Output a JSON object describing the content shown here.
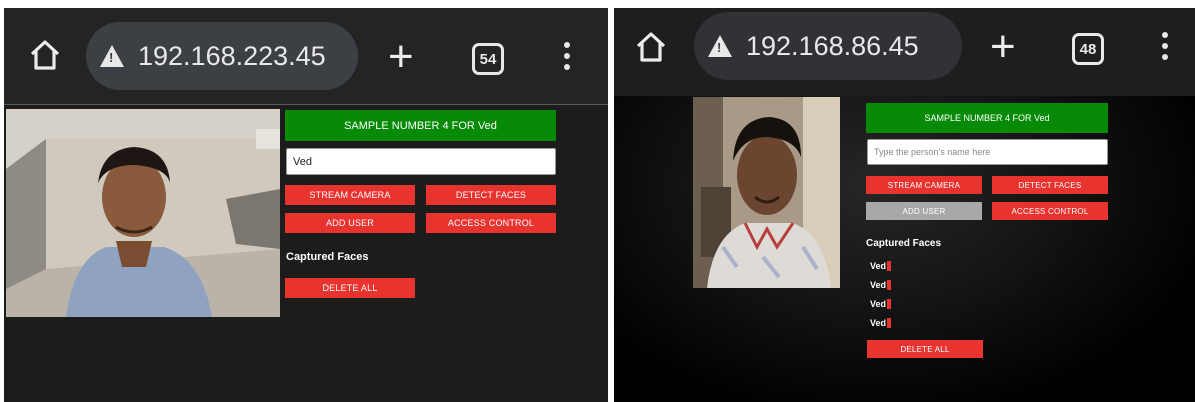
{
  "left": {
    "url": "192.168.223.45",
    "tab_count": "54",
    "banner": "SAMPLE NUMBER 4 FOR Ved",
    "name_value": "Ved",
    "buttons": {
      "stream": "STREAM CAMERA",
      "detect": "DETECT FACES",
      "add": "ADD USER",
      "access": "ACCESS CONTROL"
    },
    "captured_heading": "Captured Faces",
    "delete_all": "DELETE ALL"
  },
  "right": {
    "url": "192.168.86.45",
    "tab_count": "48",
    "banner": "SAMPLE NUMBER 4 FOR Ved",
    "name_placeholder": "Type the person's name here",
    "buttons": {
      "stream": "STREAM CAMERA",
      "detect": "DETECT FACES",
      "add": "ADD USER",
      "access": "ACCESS CONTROL"
    },
    "captured_heading": "Captured Faces",
    "faces": [
      "Ved",
      "Ved",
      "Ved",
      "Ved"
    ],
    "delete_all": "DELETE ALL"
  },
  "colors": {
    "accent_red": "#e8332f",
    "banner_green": "#078a07",
    "disabled_grey": "#a8a8a8"
  },
  "icons": [
    "home-icon",
    "warning-icon",
    "plus-icon",
    "tab-switcher-icon",
    "more-vert-icon"
  ]
}
